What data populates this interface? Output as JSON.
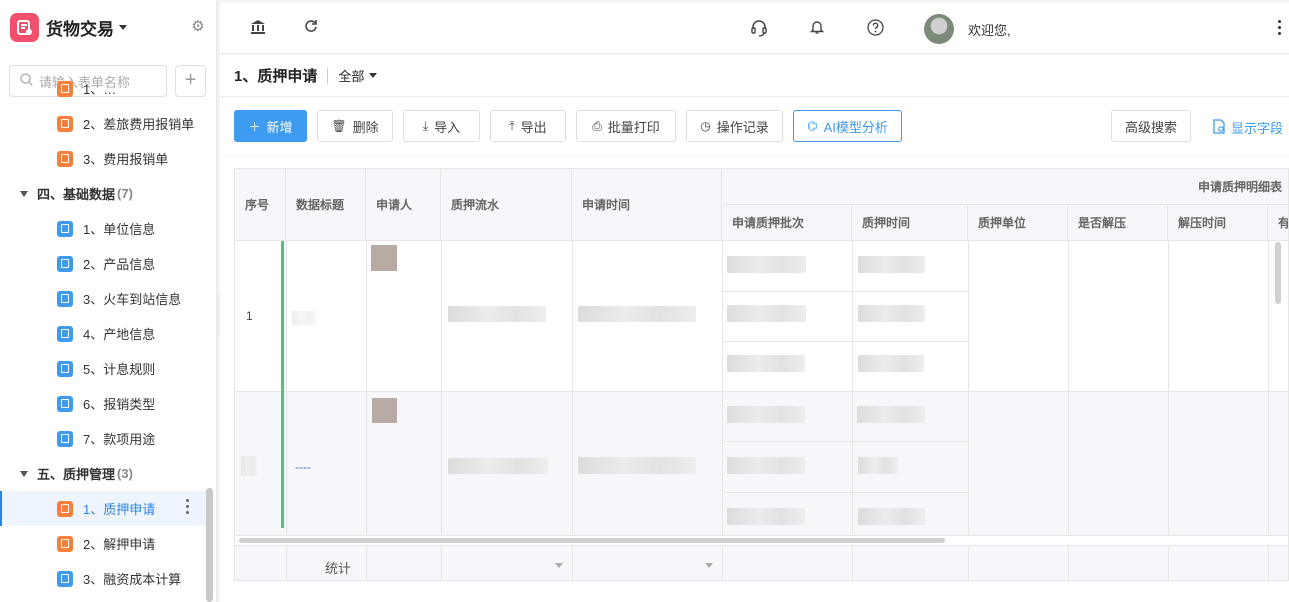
{
  "app": {
    "title": "货物交易"
  },
  "sidebar": {
    "search_placeholder": "请输入表单名称",
    "add_label": "+",
    "items": [
      {
        "type": "child",
        "label": "1、…",
        "icon": "orange"
      },
      {
        "type": "child",
        "label": "2、差旅费用报销单",
        "icon": "orange"
      },
      {
        "type": "child",
        "label": "3、费用报销单",
        "icon": "orange"
      },
      {
        "type": "group",
        "label": "四、基础数据",
        "count": "(7)"
      },
      {
        "type": "child",
        "label": "1、单位信息",
        "icon": "blue"
      },
      {
        "type": "child",
        "label": "2、产品信息",
        "icon": "blue"
      },
      {
        "type": "child",
        "label": "3、火车到站信息",
        "icon": "blue"
      },
      {
        "type": "child",
        "label": "4、产地信息",
        "icon": "blue"
      },
      {
        "type": "child",
        "label": "5、计息规则",
        "icon": "blue"
      },
      {
        "type": "child",
        "label": "6、报销类型",
        "icon": "blue"
      },
      {
        "type": "child",
        "label": "7、款项用途",
        "icon": "blue"
      },
      {
        "type": "group",
        "label": "五、质押管理",
        "count": "(3)"
      },
      {
        "type": "child",
        "label": "1、质押申请",
        "icon": "orange",
        "active": true
      },
      {
        "type": "child",
        "label": "2、解押申请",
        "icon": "orange"
      },
      {
        "type": "child",
        "label": "3、融资成本计算",
        "icon": "blue"
      }
    ]
  },
  "topbar": {
    "welcome": "欢迎您,"
  },
  "page": {
    "title": "1、质押申请",
    "view": "全部"
  },
  "toolbar": {
    "new": "新增",
    "delete": "删除",
    "import": "导入",
    "export": "导出",
    "batch_print": "批量打印",
    "op_log": "操作记录",
    "ai_analysis": "AI模型分析",
    "advanced_search": "高级搜索",
    "show_fields": "显示字段"
  },
  "table": {
    "headers": {
      "seq": "序号",
      "title": "数据标题",
      "applicant": "申请人",
      "serial": "质押流水",
      "apply_time": "申请时间",
      "detail_group": "申请质押明细表",
      "batch": "申请质押批次",
      "pledge_time": "质押时间",
      "unit": "质押单位",
      "released": "是否解压",
      "release_time": "解压时间",
      "extra": "有"
    },
    "rows": [
      {
        "seq": "1",
        "title": ""
      },
      {
        "seq": "",
        "title": "----"
      }
    ],
    "footer_label": "统计"
  },
  "colors": {
    "accent": "#3d9bf0",
    "brand": "#f0506e",
    "status_bar": "#4cc47e"
  }
}
